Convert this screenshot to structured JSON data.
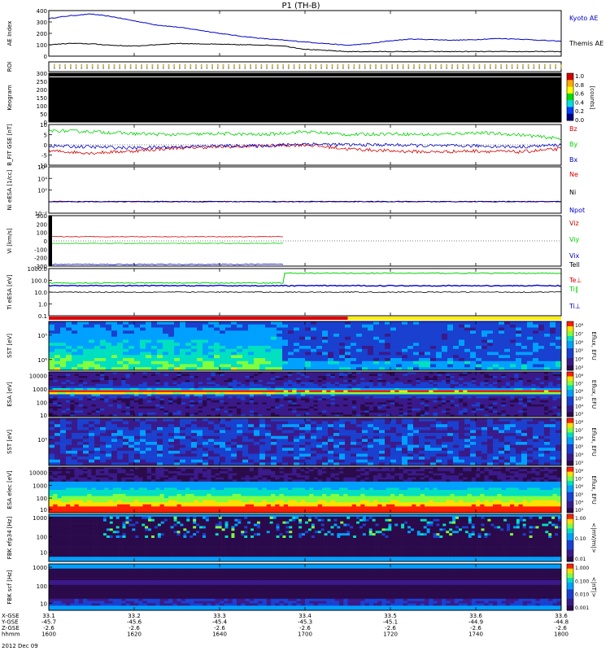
{
  "title": "P1  (TH-B)",
  "colors": {
    "axis": "#000000",
    "blue": "#0000c8",
    "red": "#d40000",
    "green": "#00d400",
    "black": "#000000",
    "bar_red": "#e00000",
    "bar_yellow": "#ffee00"
  },
  "chart_data": [
    {
      "id": "ae",
      "type": "line",
      "ylabel": "AE Index",
      "ylim": [
        0,
        400
      ],
      "yticks": [
        0,
        100,
        200,
        300,
        400
      ],
      "x": [
        1600,
        1605,
        1610,
        1615,
        1620,
        1625,
        1630,
        1635,
        1640,
        1645,
        1650,
        1655,
        1700,
        1705,
        1710,
        1715,
        1720,
        1725,
        1730,
        1735,
        1740,
        1745,
        1750,
        1755,
        1800
      ],
      "series": [
        {
          "name": "Kyoto AE",
          "color": "#0000c8",
          "values": [
            330,
            355,
            370,
            345,
            310,
            275,
            255,
            230,
            200,
            175,
            155,
            140,
            125,
            110,
            95,
            110,
            135,
            150,
            145,
            140,
            145,
            155,
            150,
            140,
            130
          ]
        },
        {
          "name": "Themis AE",
          "color": "#000000",
          "values": [
            100,
            112,
            108,
            95,
            88,
            100,
            112,
            108,
            104,
            100,
            98,
            90,
            60,
            50,
            40,
            40,
            40,
            40,
            40,
            40,
            40,
            40,
            40,
            40,
            40
          ]
        }
      ]
    },
    {
      "id": "roi",
      "type": "scatter",
      "ylabel": "ROI"
    },
    {
      "id": "keogram",
      "type": "heatmap",
      "ylabel": "Keogram",
      "ylim": [
        0,
        300
      ],
      "yticks": [
        0,
        50,
        100,
        150,
        200,
        250,
        300
      ],
      "colorbar": {
        "label": "[counts]",
        "ticks": [
          "1.0",
          "0.8",
          "0.6",
          "0.4",
          "0.2",
          "0.0"
        ]
      }
    },
    {
      "id": "bfield",
      "type": "line",
      "ylabel": "B_FIT GSE [nT]",
      "ylim": [
        -10,
        10
      ],
      "yticks": [
        -10,
        -5,
        0,
        5,
        10
      ],
      "x": [
        1600,
        1610,
        1620,
        1630,
        1640,
        1650,
        1700,
        1710,
        1720,
        1730,
        1740,
        1750,
        1800
      ],
      "series": [
        {
          "name": "Bz",
          "color": "#d40000",
          "values": [
            -3,
            -4,
            -3,
            -1.5,
            -1,
            -0.5,
            0,
            -2,
            -3,
            -3.5,
            -3,
            -3.5,
            -2
          ]
        },
        {
          "name": "By",
          "color": "#00d400",
          "values": [
            7,
            6.5,
            5.5,
            5,
            5.5,
            5,
            6.5,
            5,
            5.5,
            5,
            6,
            5,
            3
          ]
        },
        {
          "name": "Bx",
          "color": "#0000c8",
          "values": [
            -0.5,
            -1,
            -1.5,
            -1,
            -0.5,
            -0.5,
            0.5,
            0,
            0,
            -0.5,
            -0.5,
            -1,
            0
          ]
        }
      ]
    },
    {
      "id": "density",
      "type": "line",
      "ylabel": "Ni eESA [1/cc]",
      "ylim": [
        0.01,
        1000000
      ],
      "yticks_label": [
        "10²",
        "10⁴",
        "10⁶",
        "10⁻²"
      ],
      "series": [
        {
          "name": "Ne",
          "color": "#d40000",
          "value": 1
        },
        {
          "name": "Ni",
          "color": "#000000",
          "value": 1
        },
        {
          "name": "Npot",
          "color": "#0000c8",
          "value": 1
        }
      ]
    },
    {
      "id": "velocity",
      "type": "line",
      "ylabel": "Vi [km/s]",
      "ylim": [
        -300,
        300
      ],
      "yticks": [
        -300,
        -200,
        -100,
        0,
        100,
        200,
        300
      ],
      "x_end": 1655,
      "series": [
        {
          "name": "Viz",
          "color": "#d40000",
          "value": 50
        },
        {
          "name": "Viy",
          "color": "#00d400",
          "value": -30
        },
        {
          "name": "Vix",
          "color": "#0000c8",
          "value": -280
        }
      ]
    },
    {
      "id": "temperature",
      "type": "line",
      "ylabel": "Ti eESA [eV]",
      "ylim": [
        0.1,
        1000
      ],
      "yticks": [
        "1000.0",
        "100.0",
        "10.0",
        "1.0",
        "0.1"
      ],
      "series": [
        {
          "name": "Tell",
          "color": "#000000"
        },
        {
          "name": "Te⊥",
          "color": "#d40000"
        },
        {
          "name": "Ti∥",
          "color": "#00d400"
        },
        {
          "name": "Ti⊥",
          "color": "#0000c8"
        }
      ]
    },
    {
      "id": "bar",
      "type": "bar",
      "split_x": 1710
    },
    {
      "id": "sst_i",
      "type": "heatmap",
      "ylabel": "SST [eV]",
      "yticks": [
        "10⁵",
        "10⁶"
      ],
      "colorbar": {
        "label": "Eflux, EFU",
        "ticks": [
          "10⁸",
          "10⁷",
          "10⁶",
          "10⁵",
          "10⁴",
          "10³"
        ]
      }
    },
    {
      "id": "esa_i",
      "type": "heatmap",
      "ylabel": "ESA [eV]",
      "yticks": [
        "10000",
        "1000",
        "100",
        "10"
      ],
      "colorbar": {
        "label": "Eflux, EFU",
        "ticks": [
          "10⁸",
          "10⁷",
          "10⁶",
          "10⁵",
          "10⁴",
          "10³"
        ]
      }
    },
    {
      "id": "sst_e",
      "type": "heatmap",
      "ylabel": "SST [eV]",
      "yticks": [
        "10⁵"
      ],
      "colorbar": {
        "label": "Eflux, EFU",
        "ticks": [
          "10⁸",
          "10⁷",
          "10⁶",
          "10⁵",
          "10⁴",
          "10³"
        ]
      }
    },
    {
      "id": "esa_e",
      "type": "heatmap",
      "ylabel": "ESA elec [eV]",
      "yticks": [
        "10000",
        "1000",
        "100",
        "10"
      ],
      "colorbar": {
        "label": "Eflux, EFU",
        "ticks": [
          "10⁸",
          "10⁷",
          "10⁶",
          "10⁵",
          "10⁴",
          "10³"
        ]
      }
    },
    {
      "id": "fbk_e",
      "type": "heatmap",
      "ylabel": "FBK efp34 [Hz]",
      "yticks": [
        "1000",
        "100",
        "10"
      ],
      "colorbar": {
        "label": "<|mV/m|>",
        "ticks": [
          "1.00",
          "0.10",
          "0.01"
        ]
      }
    },
    {
      "id": "fbk_b",
      "type": "heatmap",
      "ylabel": "FBK scf [Hz]",
      "yticks": [
        "1000",
        "100",
        "10"
      ],
      "colorbar": {
        "label": "<|nT|>",
        "ticks": [
          "1.000",
          "0.100",
          "0.010",
          "0.001"
        ]
      }
    }
  ],
  "xaxis": {
    "row_labels": [
      "X-GSE",
      "Y-GSE",
      "Z-GSE",
      "hhmm",
      "2012 Dec 09"
    ],
    "ticks": [
      {
        "v": [
          "33.1",
          "-45.7",
          "-2.6",
          "1600"
        ]
      },
      {
        "v": [
          "33.2",
          "-45.6",
          "-2.6",
          "1620"
        ]
      },
      {
        "v": [
          "33.3",
          "-45.4",
          "-2.6",
          "1640"
        ]
      },
      {
        "v": [
          "33.4",
          "-45.3",
          "-2.6",
          "1700"
        ]
      },
      {
        "v": [
          "33.5",
          "-45.1",
          "-2.6",
          "1720"
        ]
      },
      {
        "v": [
          "33.6",
          "-44.9",
          "-2.6",
          "1740"
        ]
      },
      {
        "v": [
          "33.6",
          "-44.8",
          "-2.6",
          "1800"
        ]
      }
    ]
  }
}
